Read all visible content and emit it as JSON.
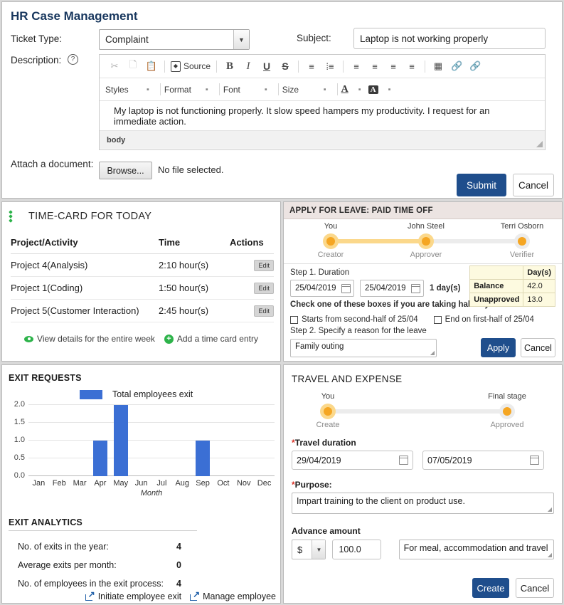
{
  "hr_case": {
    "title": "HR Case Management",
    "ticket_label": "Ticket Type:",
    "ticket_value": "Complaint",
    "subject_label": "Subject:",
    "subject_value": "Laptop is not working properly",
    "description_label": "Description:",
    "help_icon": "?",
    "toolbar_row1": [
      {
        "name": "cut-icon",
        "glyph": "✂",
        "dim": true
      },
      {
        "name": "copy-icon",
        "glyph": "❐",
        "dim": true
      },
      {
        "name": "paste-icon",
        "glyph": "ὌB",
        "dim": false
      }
    ],
    "source_label": "Source",
    "source_glyph": "◈",
    "bold_label": "B",
    "italic_label": "I",
    "underline_label": "U",
    "strike_label": "S",
    "dropdowns": [
      "Styles",
      "Format",
      "Font",
      "Size"
    ],
    "caret": "▾",
    "text_color_label": "A",
    "bg_color_label": "A",
    "editor_text": "My laptop is not functioning properly. It slow speed hampers my productivity. I request for an immediate action.",
    "editor_path": "body",
    "attach_label": "Attach a document:",
    "browse_label": "Browse...",
    "no_file_label": "No file selected.",
    "submit_label": "Submit",
    "cancel_label": "Cancel"
  },
  "timecard": {
    "title": "TIME-CARD FOR TODAY",
    "columns": [
      "Project/Activity",
      "Time",
      "Actions"
    ],
    "rows": [
      {
        "project": "Project 4(Analysis)",
        "time": "2:10 hour(s)",
        "action": "Edit"
      },
      {
        "project": "Project 1(Coding)",
        "time": "1:50 hour(s)",
        "action": "Edit"
      },
      {
        "project": "Project 5(Customer Interaction)",
        "time": "2:45 hour(s)",
        "action": "Edit"
      }
    ],
    "link_view": "View details for the entire week",
    "link_add": "Add a time card entry"
  },
  "leave": {
    "header": "APPLY FOR LEAVE: PAID TIME OFF",
    "steps": [
      {
        "top": "You",
        "bottom": "Creator"
      },
      {
        "top": "John Steel",
        "bottom": "Approver"
      },
      {
        "top": "Terri Osborn",
        "bottom": "Verifier"
      }
    ],
    "step1_label": "Step 1. Duration",
    "date_from": "25/04/2019",
    "date_to": "25/04/2019",
    "days_text": "1 day(s)",
    "halfday_note": "Check one of these boxes if you are taking half day leave",
    "chk1_label": "Starts from second-half of 25/04",
    "chk2_label": "End on first-half of 25/04",
    "step2_label": "Step 2. Specify a reason for the leave",
    "reason_value": "Family outing",
    "balance_table": {
      "header": "Day(s)",
      "rows": [
        {
          "key": "Balance",
          "value": "42.0"
        },
        {
          "key": "Unapproved",
          "value": "13.0"
        }
      ]
    },
    "apply_label": "Apply",
    "cancel_label": "Cancel",
    "accent_color": "#f5a623",
    "header_bg": "#ece4e2"
  },
  "exit": {
    "title": "EXIT REQUESTS",
    "analytics_title": "EXIT ANALYTICS",
    "analytics": [
      {
        "label": "No. of exits in the year:",
        "value": "4"
      },
      {
        "label": "Average exits per month:",
        "value": "0"
      },
      {
        "label": "No. of employees in the exit process:",
        "value": "4"
      }
    ],
    "link_initiate": "Initiate employee exit",
    "link_manage": "Manage employee"
  },
  "chart_data": {
    "type": "bar",
    "title": "EXIT REQUESTS",
    "categories": [
      "Jan",
      "Feb",
      "Mar",
      "Apr",
      "May",
      "Jun",
      "Jul",
      "Aug",
      "Sep",
      "Oct",
      "Nov",
      "Dec"
    ],
    "values": [
      0,
      0,
      0,
      1,
      2,
      0,
      0,
      0,
      1,
      0,
      0,
      0
    ],
    "series": [
      {
        "name": "Total employees exit",
        "values": [
          0,
          0,
          0,
          1,
          2,
          0,
          0,
          0,
          1,
          0,
          0,
          0
        ],
        "color": "#3b6fd4"
      }
    ],
    "xlabel": "Month",
    "ylabel": "",
    "ylim": [
      0,
      2
    ],
    "yticks": [
      "0.0",
      "0.5",
      "1.0",
      "1.5",
      "2.0"
    ],
    "ytick_values": [
      0,
      0.5,
      1.0,
      1.5,
      2.0
    ],
    "grid": true,
    "legend": [
      "Total employees exit"
    ],
    "legend_position": "top"
  },
  "travel": {
    "title": "TRAVEL AND EXPENSE",
    "steps": [
      {
        "top": "You",
        "bottom": "Create"
      },
      {
        "top": "Final stage",
        "bottom": "Approved"
      }
    ],
    "duration_label": "Travel duration",
    "date_from": "29/04/2019",
    "date_to": "07/05/2019",
    "purpose_label": "Purpose:",
    "purpose_value": "Impart training to the client on product use.",
    "advance_label": "Advance amount",
    "currency": "$",
    "amount": "100.0",
    "amount_note": "For meal, accommodation and travel",
    "create_label": "Create",
    "cancel_label": "Cancel",
    "required_mark": "*"
  }
}
